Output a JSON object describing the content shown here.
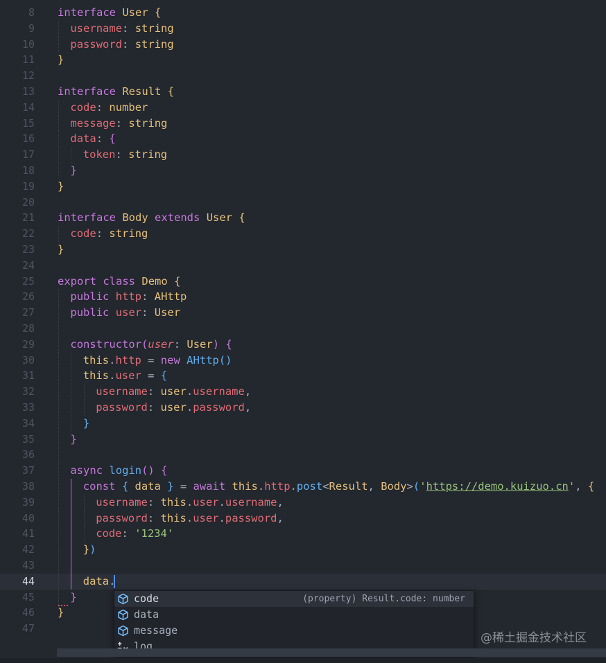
{
  "editor": {
    "active_line": "44",
    "lines": [
      {
        "n": "8",
        "indent": 0,
        "tokens": [
          [
            "kw",
            "interface"
          ],
          [
            "pl",
            " "
          ],
          [
            "ty",
            "User"
          ],
          [
            "pl",
            " "
          ],
          [
            "b1",
            "{"
          ]
        ]
      },
      {
        "n": "9",
        "indent": 1,
        "tokens": [
          [
            "pr",
            "username"
          ],
          [
            "pl",
            ": "
          ],
          [
            "ty",
            "string"
          ]
        ]
      },
      {
        "n": "10",
        "indent": 1,
        "tokens": [
          [
            "pr",
            "password"
          ],
          [
            "pl",
            ": "
          ],
          [
            "ty",
            "string"
          ]
        ]
      },
      {
        "n": "11",
        "indent": 0,
        "tokens": [
          [
            "b1",
            "}"
          ]
        ]
      },
      {
        "n": "12",
        "indent": 0,
        "tokens": []
      },
      {
        "n": "13",
        "indent": 0,
        "tokens": [
          [
            "kw",
            "interface"
          ],
          [
            "pl",
            " "
          ],
          [
            "ty",
            "Result"
          ],
          [
            "pl",
            " "
          ],
          [
            "b1",
            "{"
          ]
        ]
      },
      {
        "n": "14",
        "indent": 1,
        "tokens": [
          [
            "pr",
            "code"
          ],
          [
            "pl",
            ": "
          ],
          [
            "ty",
            "number"
          ]
        ]
      },
      {
        "n": "15",
        "indent": 1,
        "tokens": [
          [
            "pr",
            "message"
          ],
          [
            "pl",
            ": "
          ],
          [
            "ty",
            "string"
          ]
        ]
      },
      {
        "n": "16",
        "indent": 1,
        "tokens": [
          [
            "pr",
            "data"
          ],
          [
            "pl",
            ": "
          ],
          [
            "b2",
            "{"
          ]
        ]
      },
      {
        "n": "17",
        "indent": 2,
        "tokens": [
          [
            "pr",
            "token"
          ],
          [
            "pl",
            ": "
          ],
          [
            "ty",
            "string"
          ]
        ]
      },
      {
        "n": "18",
        "indent": 1,
        "tokens": [
          [
            "b2",
            "}"
          ]
        ]
      },
      {
        "n": "19",
        "indent": 0,
        "tokens": [
          [
            "b1",
            "}"
          ]
        ]
      },
      {
        "n": "20",
        "indent": 0,
        "tokens": []
      },
      {
        "n": "21",
        "indent": 0,
        "tokens": [
          [
            "kw",
            "interface"
          ],
          [
            "pl",
            " "
          ],
          [
            "ty",
            "Body"
          ],
          [
            "pl",
            " "
          ],
          [
            "kw",
            "extends"
          ],
          [
            "pl",
            " "
          ],
          [
            "ty",
            "User"
          ],
          [
            "pl",
            " "
          ],
          [
            "b1",
            "{"
          ]
        ]
      },
      {
        "n": "22",
        "indent": 1,
        "tokens": [
          [
            "pr",
            "code"
          ],
          [
            "pl",
            ": "
          ],
          [
            "ty",
            "string"
          ]
        ]
      },
      {
        "n": "23",
        "indent": 0,
        "tokens": [
          [
            "b1",
            "}"
          ]
        ]
      },
      {
        "n": "24",
        "indent": 0,
        "tokens": []
      },
      {
        "n": "25",
        "indent": 0,
        "tokens": [
          [
            "kw",
            "export"
          ],
          [
            "pl",
            " "
          ],
          [
            "kw",
            "class"
          ],
          [
            "pl",
            " "
          ],
          [
            "ty",
            "Demo"
          ],
          [
            "pl",
            " "
          ],
          [
            "b1",
            "{"
          ]
        ]
      },
      {
        "n": "26",
        "indent": 1,
        "tokens": [
          [
            "kw",
            "public"
          ],
          [
            "pl",
            " "
          ],
          [
            "pr",
            "http"
          ],
          [
            "pl",
            ": "
          ],
          [
            "ty",
            "AHttp"
          ]
        ]
      },
      {
        "n": "27",
        "indent": 1,
        "tokens": [
          [
            "kw",
            "public"
          ],
          [
            "pl",
            " "
          ],
          [
            "pr",
            "user"
          ],
          [
            "pl",
            ": "
          ],
          [
            "ty",
            "User"
          ]
        ]
      },
      {
        "n": "28",
        "indent": 0,
        "tokens": []
      },
      {
        "n": "29",
        "indent": 1,
        "tokens": [
          [
            "kw",
            "constructor"
          ],
          [
            "b2",
            "("
          ],
          [
            "pa",
            "user"
          ],
          [
            "pl",
            ": "
          ],
          [
            "ty",
            "User"
          ],
          [
            "b2",
            ")"
          ],
          [
            "pl",
            " "
          ],
          [
            "b2",
            "{"
          ]
        ]
      },
      {
        "n": "30",
        "indent": 2,
        "tokens": [
          [
            "ty",
            "this"
          ],
          [
            "pl",
            "."
          ],
          [
            "pr",
            "http"
          ],
          [
            "pl",
            " = "
          ],
          [
            "kw",
            "new"
          ],
          [
            "pl",
            " "
          ],
          [
            "fn",
            "AHttp"
          ],
          [
            "b3",
            "()"
          ]
        ]
      },
      {
        "n": "31",
        "indent": 2,
        "tokens": [
          [
            "ty",
            "this"
          ],
          [
            "pl",
            "."
          ],
          [
            "pr",
            "user"
          ],
          [
            "pl",
            " = "
          ],
          [
            "b3",
            "{"
          ]
        ]
      },
      {
        "n": "32",
        "indent": 3,
        "tokens": [
          [
            "pr",
            "username"
          ],
          [
            "pl",
            ": "
          ],
          [
            "ty",
            "user"
          ],
          [
            "pl",
            "."
          ],
          [
            "pr",
            "username"
          ],
          [
            "pl",
            ","
          ]
        ]
      },
      {
        "n": "33",
        "indent": 3,
        "tokens": [
          [
            "pr",
            "password"
          ],
          [
            "pl",
            ": "
          ],
          [
            "ty",
            "user"
          ],
          [
            "pl",
            "."
          ],
          [
            "pr",
            "password"
          ],
          [
            "pl",
            ","
          ]
        ]
      },
      {
        "n": "34",
        "indent": 2,
        "tokens": [
          [
            "b3",
            "}"
          ]
        ]
      },
      {
        "n": "35",
        "indent": 1,
        "tokens": [
          [
            "b2",
            "}"
          ]
        ]
      },
      {
        "n": "36",
        "indent": 0,
        "tokens": []
      },
      {
        "n": "37",
        "indent": 1,
        "tokens": [
          [
            "kw",
            "async"
          ],
          [
            "pl",
            " "
          ],
          [
            "fn",
            "login"
          ],
          [
            "b2",
            "()"
          ],
          [
            "pl",
            " "
          ],
          [
            "b2",
            "{"
          ]
        ]
      },
      {
        "n": "38",
        "indent": 2,
        "tokens": [
          [
            "kw",
            "const"
          ],
          [
            "pl",
            " "
          ],
          [
            "b3",
            "{"
          ],
          [
            "pl",
            " "
          ],
          [
            "ty",
            "data"
          ],
          [
            "pl",
            " "
          ],
          [
            "b3",
            "}"
          ],
          [
            "pl",
            " = "
          ],
          [
            "kw",
            "await"
          ],
          [
            "pl",
            " "
          ],
          [
            "ty",
            "this"
          ],
          [
            "pl",
            "."
          ],
          [
            "pr",
            "http"
          ],
          [
            "pl",
            "."
          ],
          [
            "fn",
            "post"
          ],
          [
            "pl",
            "<"
          ],
          [
            "ty",
            "Result"
          ],
          [
            "pl",
            ", "
          ],
          [
            "ty",
            "Body"
          ],
          [
            "pl",
            ">"
          ],
          [
            "b3",
            "("
          ],
          [
            "st",
            "'"
          ],
          [
            "ur",
            "https://demo.kuizuo.cn"
          ],
          [
            "st",
            "'"
          ],
          [
            "pl",
            ", "
          ],
          [
            "b1",
            "{"
          ]
        ]
      },
      {
        "n": "39",
        "indent": 3,
        "tokens": [
          [
            "pr",
            "username"
          ],
          [
            "pl",
            ": "
          ],
          [
            "ty",
            "this"
          ],
          [
            "pl",
            "."
          ],
          [
            "pr",
            "user"
          ],
          [
            "pl",
            "."
          ],
          [
            "pr",
            "username"
          ],
          [
            "pl",
            ","
          ]
        ]
      },
      {
        "n": "40",
        "indent": 3,
        "tokens": [
          [
            "pr",
            "password"
          ],
          [
            "pl",
            ": "
          ],
          [
            "ty",
            "this"
          ],
          [
            "pl",
            "."
          ],
          [
            "pr",
            "user"
          ],
          [
            "pl",
            "."
          ],
          [
            "pr",
            "password"
          ],
          [
            "pl",
            ","
          ]
        ]
      },
      {
        "n": "41",
        "indent": 3,
        "tokens": [
          [
            "pr",
            "code"
          ],
          [
            "pl",
            ": "
          ],
          [
            "st",
            "'1234'"
          ]
        ]
      },
      {
        "n": "42",
        "indent": 2,
        "tokens": [
          [
            "b1",
            "}"
          ],
          [
            "b3",
            ")"
          ]
        ]
      },
      {
        "n": "43",
        "indent": 0,
        "tokens": []
      },
      {
        "n": "44",
        "indent": 2,
        "tokens": [
          [
            "ty",
            "data"
          ],
          [
            "pl",
            "."
          ]
        ]
      },
      {
        "n": "45",
        "indent": 1,
        "tokens": [
          [
            "b2",
            "}"
          ]
        ]
      },
      {
        "n": "46",
        "indent": 0,
        "tokens": [
          [
            "b1",
            "}"
          ]
        ]
      },
      {
        "n": "47",
        "indent": 0,
        "tokens": []
      }
    ]
  },
  "suggest": {
    "items": [
      {
        "label": "code",
        "kind": "property",
        "icon": "cube-icon",
        "detail": "(property) Result.code: number",
        "selected": true
      },
      {
        "label": "data",
        "kind": "property",
        "icon": "cube-icon",
        "detail": "",
        "selected": false
      },
      {
        "label": "message",
        "kind": "property",
        "icon": "cube-icon",
        "detail": "",
        "selected": false
      },
      {
        "label": "log",
        "kind": "snippet",
        "icon": "snippet-icon",
        "detail": "",
        "selected": false
      }
    ]
  },
  "watermark": "@稀土掘金技术社区",
  "colors": {
    "background": "#23272e",
    "keyword": "#c678dd",
    "type": "#e5c07b",
    "property": "#e06c75",
    "function": "#61afef",
    "string": "#98c379",
    "cube_icon": "#75beff"
  }
}
